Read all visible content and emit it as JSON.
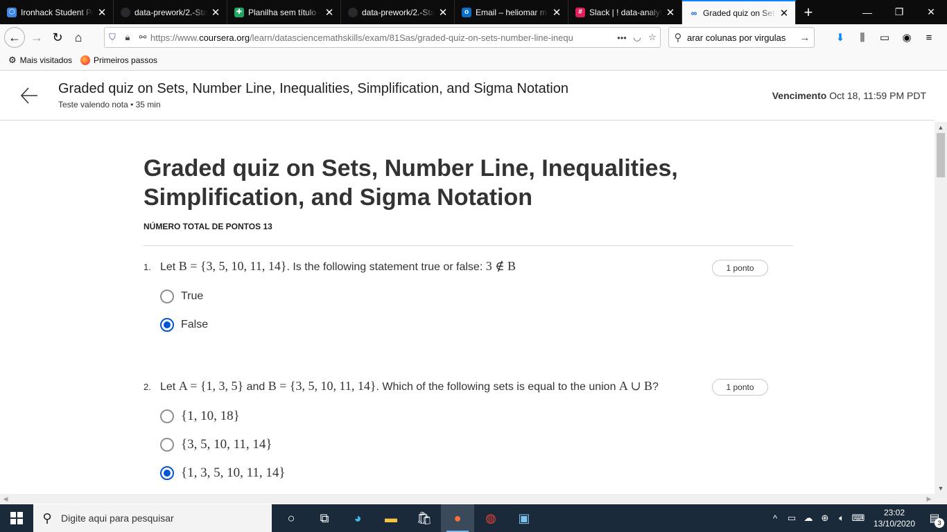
{
  "browser": {
    "tabs": [
      {
        "title": "Ironhack Student Po",
        "icon": "ironhack-icon",
        "color": "#3f86e6",
        "active": false
      },
      {
        "title": "data-prework/2.-Sta",
        "icon": "github-icon",
        "color": "#2a2a2e",
        "active": false
      },
      {
        "title": "Planilha sem título -",
        "icon": "sheets-icon",
        "color": "#23a566",
        "active": false
      },
      {
        "title": "data-prework/2.-Sta",
        "icon": "github-icon",
        "color": "#2a2a2e",
        "active": false
      },
      {
        "title": "Email – heliomar m",
        "icon": "outlook-icon",
        "color": "#0a6ecb",
        "active": false
      },
      {
        "title": "Slack | ! data-analyti",
        "icon": "slack-icon",
        "color": "#e01e5a",
        "active": false
      },
      {
        "title": "Graded quiz on Sets",
        "icon": "coursera-icon",
        "color": "#0056d2",
        "active": true
      }
    ],
    "url_prefix": "https://www.",
    "url_domain": "coursera.org",
    "url_rest": "/learn/datasciencemathskills/exam/81Sas/graded-quiz-on-sets-number-line-inequ",
    "search_value": "arar colunas por virgulas",
    "bookmarks": [
      {
        "label": "Mais visitados",
        "icon": "gear-icon"
      },
      {
        "label": "Primeiros passos",
        "icon": "firefox-icon"
      }
    ]
  },
  "header": {
    "title": "Graded quiz on Sets, Number Line, Inequalities, Simplification, and Sigma Notation",
    "subtitle": "Teste valendo nota • 35 min",
    "due_label": "Vencimento",
    "due_value": "Oct 18, 11:59 PM PDT"
  },
  "quiz": {
    "title": "Graded quiz on Sets, Number Line, Inequalities, Simplification, and Sigma Notation",
    "points_total": "NÚMERO TOTAL DE PONTOS 13",
    "questions": [
      {
        "number": "1.",
        "points": "1 ponto",
        "text_1": "Let ",
        "math_1": "B = {3, 5, 10, 11, 14}",
        "text_2": ". Is the following statement true or false: ",
        "math_2": "3 ∉ B",
        "options": [
          {
            "label": "True",
            "selected": false
          },
          {
            "label": "False",
            "selected": true
          }
        ]
      },
      {
        "number": "2.",
        "points": "1 ponto",
        "text_1": "Let ",
        "math_1": "A = {1, 3, 5}",
        "text_2": " and ",
        "math_2": "B = {3, 5, 10, 11, 14}",
        "text_3": ". Which of the following sets is equal to the union ",
        "math_3": "A ∪ B",
        "text_4": "?",
        "options": [
          {
            "label": "{1, 10, 18}",
            "selected": false
          },
          {
            "label": "{3, 5, 10, 11, 14}",
            "selected": false
          },
          {
            "label": "{1, 3, 5, 10, 11, 14}",
            "selected": true
          }
        ]
      }
    ]
  },
  "taskbar": {
    "search_placeholder": "Digite aqui para pesquisar",
    "time": "23:02",
    "date": "13/10/2020",
    "notification_count": "3"
  },
  "colors": {
    "accent": "#0056d2",
    "taskbar": "#1a2a3a",
    "tabstrip": "#0c0c0d"
  }
}
